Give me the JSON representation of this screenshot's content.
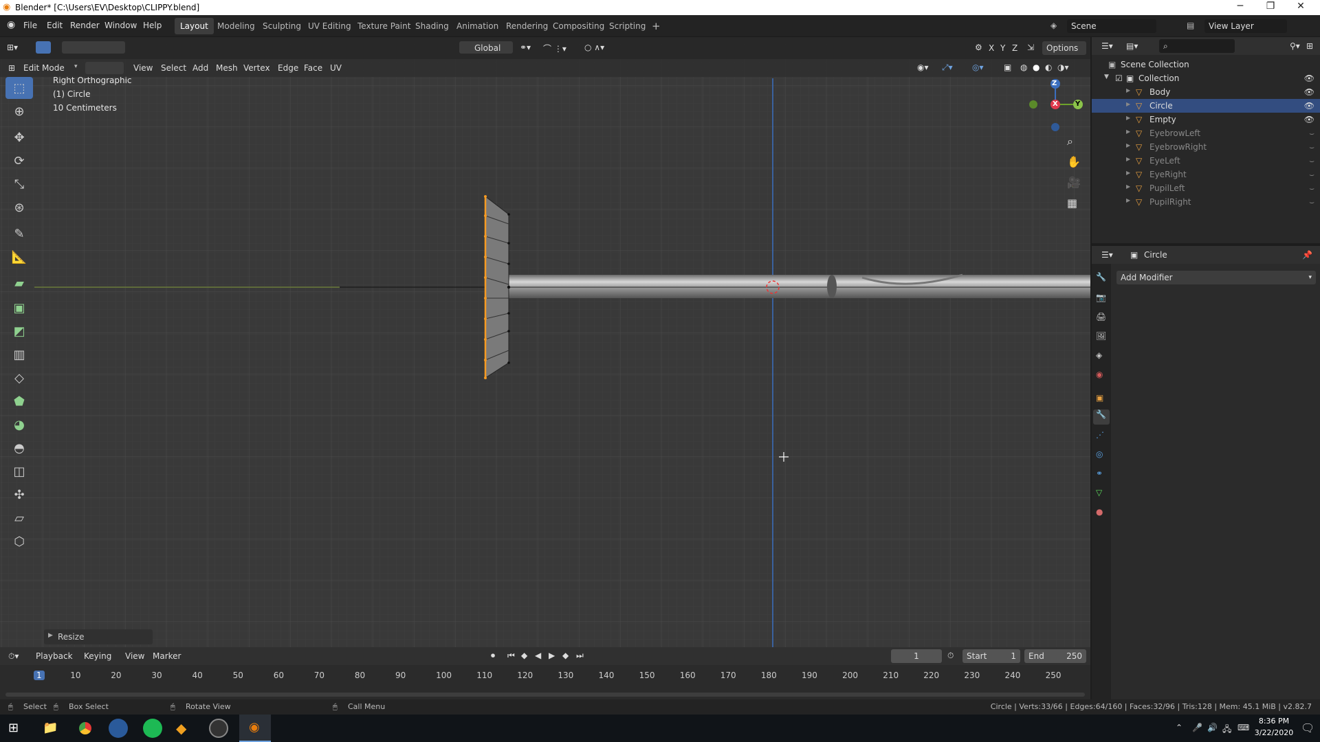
{
  "title": "Blender* [C:\\Users\\EV\\Desktop\\CLIPPY.blend]",
  "menus": [
    "File",
    "Edit",
    "Render",
    "Window",
    "Help"
  ],
  "workspaces": [
    "Layout",
    "Modeling",
    "Sculpting",
    "UV Editing",
    "Texture Paint",
    "Shading",
    "Animation",
    "Rendering",
    "Compositing",
    "Scripting"
  ],
  "active_workspace": "Layout",
  "scene": "Scene",
  "view_layer": "View Layer",
  "viewport": {
    "mode": "Edit Mode",
    "header_menus": [
      "View",
      "Select",
      "Add",
      "Mesh",
      "Vertex",
      "Edge",
      "Face",
      "UV"
    ],
    "transform_orientation": "Global",
    "options": "Options",
    "axes": [
      "X",
      "Y",
      "Z"
    ],
    "overlay_view": "Right Orthographic",
    "overlay_object": "(1) Circle",
    "overlay_scale": "10 Centimeters",
    "gizmo": {
      "z": "Z",
      "y": "Y",
      "x": "X"
    },
    "last_op": "Resize"
  },
  "outliner": {
    "root": "Scene Collection",
    "collection": "Collection",
    "items": [
      {
        "name": "Body",
        "selected": false,
        "visible": true
      },
      {
        "name": "Circle",
        "selected": true,
        "visible": true
      },
      {
        "name": "Empty",
        "selected": false,
        "visible": true
      },
      {
        "name": "EyebrowLeft",
        "selected": false,
        "visible": false
      },
      {
        "name": "EyebrowRight",
        "selected": false,
        "visible": false
      },
      {
        "name": "EyeLeft",
        "selected": false,
        "visible": false
      },
      {
        "name": "EyeRight",
        "selected": false,
        "visible": false
      },
      {
        "name": "PupilLeft",
        "selected": false,
        "visible": false
      },
      {
        "name": "PupilRight",
        "selected": false,
        "visible": false
      }
    ]
  },
  "properties": {
    "object": "Circle",
    "add_modifier": "Add Modifier"
  },
  "timeline": {
    "menus": [
      "Playback",
      "Keying",
      "View",
      "Marker"
    ],
    "current_frame": "1",
    "start_label": "Start",
    "start": "1",
    "end_label": "End",
    "end": "250",
    "ruler": [
      "1",
      "10",
      "20",
      "30",
      "40",
      "50",
      "60",
      "70",
      "80",
      "90",
      "100",
      "110",
      "120",
      "130",
      "140",
      "150",
      "160",
      "170",
      "180",
      "190",
      "200",
      "210",
      "220",
      "230",
      "240",
      "250"
    ]
  },
  "status": {
    "select": "Select",
    "box_select": "Box Select",
    "rotate": "Rotate View",
    "call_menu": "Call Menu",
    "stats": "Circle | Verts:33/66 | Edges:64/160 | Faces:32/96 | Tris:128 | Mem: 45.1 MiB | v2.82.7"
  },
  "taskbar": {
    "time": "8:36 PM",
    "date": "3/22/2020"
  }
}
